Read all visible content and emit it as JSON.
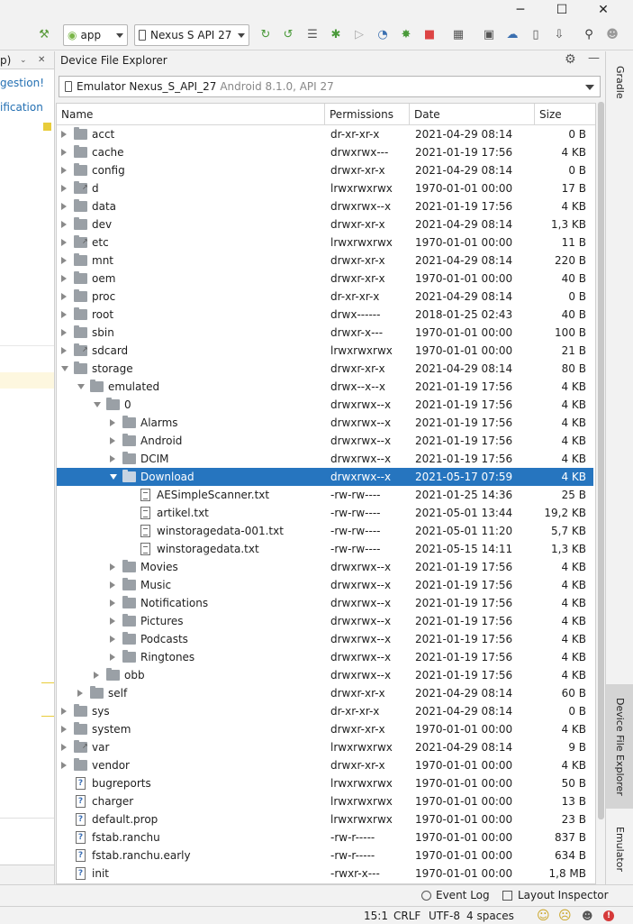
{
  "window": {
    "minimize": "─",
    "maximize": "☐",
    "close": "✕"
  },
  "toolbar": {
    "run_config": "app",
    "device": "Nexus S API 27"
  },
  "left_panel": {
    "tab": "p)",
    "link1": "gestion!",
    "link2": "ification"
  },
  "dfe": {
    "title": "Device File Explorer",
    "device_name": "Emulator Nexus_S_API_27",
    "device_info": "Android 8.1.0, API 27",
    "columns": [
      "Name",
      "Permissions",
      "Date",
      "Size"
    ],
    "rows": [
      {
        "name": "acct",
        "perm": "dr-xr-xr-x",
        "date": "2021-04-29 08:14",
        "size": "0 B",
        "depth": 0,
        "kind": "folder",
        "state": "closed"
      },
      {
        "name": "cache",
        "perm": "drwxrwx---",
        "date": "2021-01-19 17:56",
        "size": "4 KB",
        "depth": 0,
        "kind": "folder",
        "state": "closed"
      },
      {
        "name": "config",
        "perm": "drwxr-xr-x",
        "date": "2021-04-29 08:14",
        "size": "0 B",
        "depth": 0,
        "kind": "folder",
        "state": "closed"
      },
      {
        "name": "d",
        "perm": "lrwxrwxrwx",
        "date": "1970-01-01 00:00",
        "size": "17 B",
        "depth": 0,
        "kind": "link",
        "state": "closed"
      },
      {
        "name": "data",
        "perm": "drwxrwx--x",
        "date": "2021-01-19 17:56",
        "size": "4 KB",
        "depth": 0,
        "kind": "folder",
        "state": "closed"
      },
      {
        "name": "dev",
        "perm": "drwxr-xr-x",
        "date": "2021-04-29 08:14",
        "size": "1,3 KB",
        "depth": 0,
        "kind": "folder",
        "state": "closed"
      },
      {
        "name": "etc",
        "perm": "lrwxrwxrwx",
        "date": "1970-01-01 00:00",
        "size": "11 B",
        "depth": 0,
        "kind": "link",
        "state": "closed"
      },
      {
        "name": "mnt",
        "perm": "drwxr-xr-x",
        "date": "2021-04-29 08:14",
        "size": "220 B",
        "depth": 0,
        "kind": "folder",
        "state": "closed"
      },
      {
        "name": "oem",
        "perm": "drwxr-xr-x",
        "date": "1970-01-01 00:00",
        "size": "40 B",
        "depth": 0,
        "kind": "folder",
        "state": "closed"
      },
      {
        "name": "proc",
        "perm": "dr-xr-xr-x",
        "date": "2021-04-29 08:14",
        "size": "0 B",
        "depth": 0,
        "kind": "folder",
        "state": "closed"
      },
      {
        "name": "root",
        "perm": "drwx------",
        "date": "2018-01-25 02:43",
        "size": "40 B",
        "depth": 0,
        "kind": "folder",
        "state": "closed"
      },
      {
        "name": "sbin",
        "perm": "drwxr-x---",
        "date": "1970-01-01 00:00",
        "size": "100 B",
        "depth": 0,
        "kind": "folder",
        "state": "closed"
      },
      {
        "name": "sdcard",
        "perm": "lrwxrwxrwx",
        "date": "1970-01-01 00:00",
        "size": "21 B",
        "depth": 0,
        "kind": "link",
        "state": "closed"
      },
      {
        "name": "storage",
        "perm": "drwxr-xr-x",
        "date": "2021-04-29 08:14",
        "size": "80 B",
        "depth": 0,
        "kind": "folder",
        "state": "open"
      },
      {
        "name": "emulated",
        "perm": "drwx--x--x",
        "date": "2021-01-19 17:56",
        "size": "4 KB",
        "depth": 1,
        "kind": "folder",
        "state": "open"
      },
      {
        "name": "0",
        "perm": "drwxrwx--x",
        "date": "2021-01-19 17:56",
        "size": "4 KB",
        "depth": 2,
        "kind": "folder",
        "state": "open"
      },
      {
        "name": "Alarms",
        "perm": "drwxrwx--x",
        "date": "2021-01-19 17:56",
        "size": "4 KB",
        "depth": 3,
        "kind": "folder",
        "state": "closed"
      },
      {
        "name": "Android",
        "perm": "drwxrwx--x",
        "date": "2021-01-19 17:56",
        "size": "4 KB",
        "depth": 3,
        "kind": "folder",
        "state": "closed"
      },
      {
        "name": "DCIM",
        "perm": "drwxrwx--x",
        "date": "2021-01-19 17:56",
        "size": "4 KB",
        "depth": 3,
        "kind": "folder",
        "state": "closed"
      },
      {
        "name": "Download",
        "perm": "drwxrwx--x",
        "date": "2021-05-17 07:59",
        "size": "4 KB",
        "depth": 3,
        "kind": "folder",
        "state": "open",
        "selected": true
      },
      {
        "name": "AESimpleScanner.txt",
        "perm": "-rw-rw----",
        "date": "2021-01-25 14:36",
        "size": "25 B",
        "depth": 4,
        "kind": "file",
        "state": "none"
      },
      {
        "name": "artikel.txt",
        "perm": "-rw-rw----",
        "date": "2021-05-01 13:44",
        "size": "19,2 KB",
        "depth": 4,
        "kind": "file",
        "state": "none"
      },
      {
        "name": "winstoragedata-001.txt",
        "perm": "-rw-rw----",
        "date": "2021-05-01 11:20",
        "size": "5,7 KB",
        "depth": 4,
        "kind": "file",
        "state": "none"
      },
      {
        "name": "winstoragedata.txt",
        "perm": "-rw-rw----",
        "date": "2021-05-15 14:11",
        "size": "1,3 KB",
        "depth": 4,
        "kind": "file",
        "state": "none"
      },
      {
        "name": "Movies",
        "perm": "drwxrwx--x",
        "date": "2021-01-19 17:56",
        "size": "4 KB",
        "depth": 3,
        "kind": "folder",
        "state": "closed"
      },
      {
        "name": "Music",
        "perm": "drwxrwx--x",
        "date": "2021-01-19 17:56",
        "size": "4 KB",
        "depth": 3,
        "kind": "folder",
        "state": "closed"
      },
      {
        "name": "Notifications",
        "perm": "drwxrwx--x",
        "date": "2021-01-19 17:56",
        "size": "4 KB",
        "depth": 3,
        "kind": "folder",
        "state": "closed"
      },
      {
        "name": "Pictures",
        "perm": "drwxrwx--x",
        "date": "2021-01-19 17:56",
        "size": "4 KB",
        "depth": 3,
        "kind": "folder",
        "state": "closed"
      },
      {
        "name": "Podcasts",
        "perm": "drwxrwx--x",
        "date": "2021-01-19 17:56",
        "size": "4 KB",
        "depth": 3,
        "kind": "folder",
        "state": "closed"
      },
      {
        "name": "Ringtones",
        "perm": "drwxrwx--x",
        "date": "2021-01-19 17:56",
        "size": "4 KB",
        "depth": 3,
        "kind": "folder",
        "state": "closed"
      },
      {
        "name": "obb",
        "perm": "drwxrwx--x",
        "date": "2021-01-19 17:56",
        "size": "4 KB",
        "depth": 2,
        "kind": "folder",
        "state": "closed"
      },
      {
        "name": "self",
        "perm": "drwxr-xr-x",
        "date": "2021-04-29 08:14",
        "size": "60 B",
        "depth": 1,
        "kind": "folder",
        "state": "closed"
      },
      {
        "name": "sys",
        "perm": "dr-xr-xr-x",
        "date": "2021-04-29 08:14",
        "size": "0 B",
        "depth": 0,
        "kind": "folder",
        "state": "closed"
      },
      {
        "name": "system",
        "perm": "drwxr-xr-x",
        "date": "1970-01-01 00:00",
        "size": "4 KB",
        "depth": 0,
        "kind": "folder",
        "state": "closed"
      },
      {
        "name": "var",
        "perm": "lrwxrwxrwx",
        "date": "2021-04-29 08:14",
        "size": "9 B",
        "depth": 0,
        "kind": "link",
        "state": "closed"
      },
      {
        "name": "vendor",
        "perm": "drwxr-xr-x",
        "date": "1970-01-01 00:00",
        "size": "4 KB",
        "depth": 0,
        "kind": "folder",
        "state": "closed"
      },
      {
        "name": "bugreports",
        "perm": "lrwxrwxrwx",
        "date": "1970-01-01 00:00",
        "size": "50 B",
        "depth": 0,
        "kind": "qfile",
        "state": "none"
      },
      {
        "name": "charger",
        "perm": "lrwxrwxrwx",
        "date": "1970-01-01 00:00",
        "size": "13 B",
        "depth": 0,
        "kind": "qfile",
        "state": "none"
      },
      {
        "name": "default.prop",
        "perm": "lrwxrwxrwx",
        "date": "1970-01-01 00:00",
        "size": "23 B",
        "depth": 0,
        "kind": "qfile",
        "state": "none"
      },
      {
        "name": "fstab.ranchu",
        "perm": "-rw-r-----",
        "date": "1970-01-01 00:00",
        "size": "837 B",
        "depth": 0,
        "kind": "qfile",
        "state": "none"
      },
      {
        "name": "fstab.ranchu.early",
        "perm": "-rw-r-----",
        "date": "1970-01-01 00:00",
        "size": "634 B",
        "depth": 0,
        "kind": "qfile",
        "state": "none"
      },
      {
        "name": "init",
        "perm": "-rwxr-x---",
        "date": "1970-01-01 00:00",
        "size": "1,8 MB",
        "depth": 0,
        "kind": "qfile",
        "state": "none"
      }
    ]
  },
  "right_strip": {
    "gradle": "Gradle",
    "device_file_explorer": "Device File Explorer",
    "emulator": "Emulator"
  },
  "bottom_bar": {
    "event_log": "Event Log",
    "layout_inspector": "Layout Inspector"
  },
  "status_bar": {
    "position": "15:1",
    "line_sep": "CRLF",
    "encoding": "UTF-8",
    "indent": "4 spaces"
  },
  "colors": {
    "selection": "#2675bf",
    "folder": "#9aa0a6",
    "accent_link": "#2470b3"
  }
}
